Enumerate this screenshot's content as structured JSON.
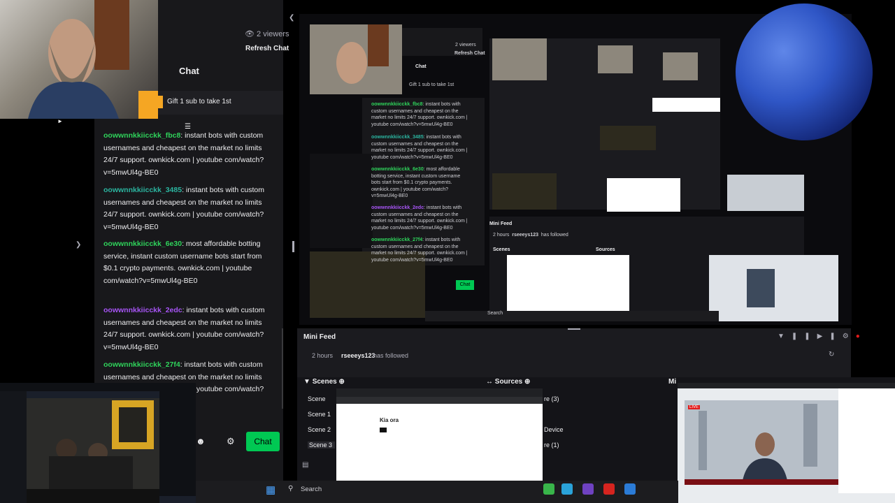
{
  "header": {
    "viewers": "2 viewers",
    "refresh_chat": "Refresh Chat",
    "chat_title": "Chat"
  },
  "gift": {
    "text": "Gift 1 sub to take 1st"
  },
  "chat": {
    "messages": [
      {
        "user": "oowwnnkkiicckk_fbc8",
        "text": ": instant bots with custom usernames and cheapest on the market no limits 24/7 support. ownkick.com | youtube com/watch?v=5mwUl4g-BE0",
        "color": "#2fd35b"
      },
      {
        "user": "oowwnnkkiicckk_3485",
        "text": ": instant bots with custom usernames and cheapest on the market no limits 24/7 support. ownkick.com | youtube com/watch?v=5mwUl4g-BE0",
        "color": "#2bb5a0"
      },
      {
        "user": "oowwnnkkiicckk_6e30",
        "text": ": most affordable botting service, instant custom username bots start from $0.1 crypto payments. ownkick.com | youtube com/watch?v=5mwUl4g-BE0",
        "color": "#2fd35b"
      },
      {
        "user": "oowwnnkkiicckk_2edc",
        "text": ": instant bots with custom usernames and cheapest on the market no limits 24/7 support. ownkick.com | youtube com/watch?v=5mwUl4g-BE0",
        "color": "#a855f7"
      },
      {
        "user": "oowwnnkkiicckk_27f4",
        "text": ": instant bots with custom usernames and cheapest on the market no limits 24/7 support. ownkick.com | youtube com/watch?v=5mwUl4g-BE0",
        "color": "#2fd35b"
      }
    ],
    "send_label": "Chat"
  },
  "mini_feed": {
    "title": "Mini Feed",
    "time": "2 hours",
    "user": "rseeeys123",
    "action": "has followed"
  },
  "docks": {
    "scenes_title": "Scenes",
    "sources_title": "Sources",
    "mixer_title": "Mi",
    "scenes": [
      "Scene",
      "Scene 1",
      "Scene 2",
      "Scene 3"
    ],
    "source_fragments": [
      "re (3)",
      "Device",
      "re (1)"
    ]
  },
  "browser_thumb": {
    "heading": "Kia ora"
  },
  "news_thumb": {
    "live": "LIVE"
  },
  "taskbar": {
    "search": "Search"
  },
  "colors": {
    "accent_green": "#00c853",
    "panel_bg": "#18181b",
    "live_red": "#e21b1b"
  },
  "icons": [
    "eye-icon",
    "gift-icon",
    "chevron-left-icon",
    "emoji-icon",
    "gear-icon",
    "filter-icon",
    "pause-icon",
    "skip-icon",
    "mute-icon",
    "refresh-icon",
    "windows-icon",
    "search-icon"
  ]
}
